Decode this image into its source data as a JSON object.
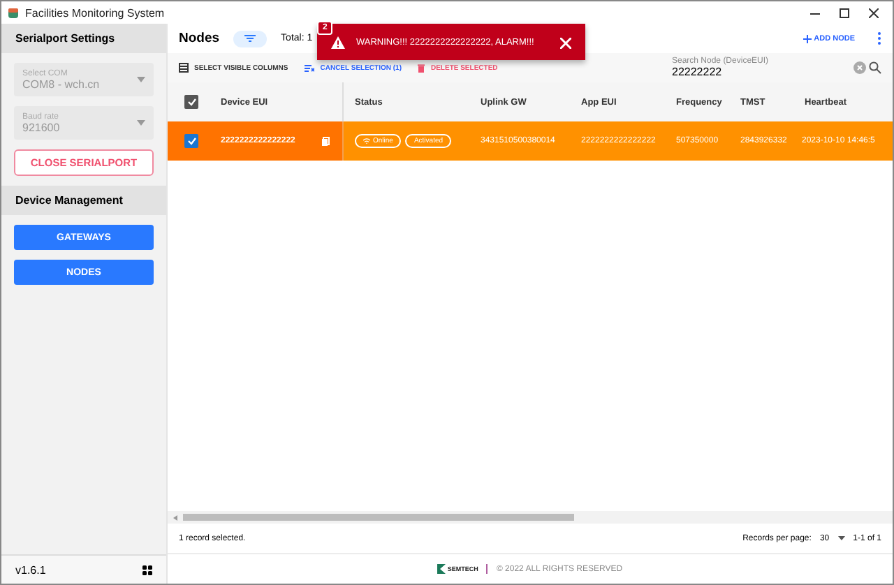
{
  "window": {
    "title": "Facilities Monitoring System"
  },
  "sidebar": {
    "serial_title": "Serialport Settings",
    "fields": [
      {
        "label": "Select COM",
        "value": "COM8 - wch.cn",
        "disabled": true
      },
      {
        "label": "Baud rate",
        "value": "921600",
        "disabled": true
      }
    ],
    "close_button": "CLOSE SERIALPORT",
    "management_title": "Device Management",
    "nav": [
      {
        "label": "GATEWAYS"
      },
      {
        "label": "NODES"
      }
    ],
    "version": "v1.6.1"
  },
  "header": {
    "title": "Nodes",
    "total": "Total: 1",
    "add_button": "ADD NODE"
  },
  "toast": {
    "count": "2",
    "message": "WARNING!!! 2222222222222222, ALARM!!!"
  },
  "toolbar": {
    "columns_button": "SELECT VISIBLE COLUMNS",
    "cancel_button": "CANCEL SELECTION (1)",
    "delete_button": "DELETE SELECTED",
    "search": {
      "label": "Search Node (DeviceEUI)",
      "value": "22222222"
    }
  },
  "table": {
    "all_checked": true,
    "columns": [
      "Device EUI",
      "Status",
      "Uplink GW",
      "App EUI",
      "Frequency",
      "TMST",
      "Heartbeat"
    ],
    "rows": [
      {
        "checked": true,
        "selected": true,
        "device_eui": "2222222222222222",
        "status": [
          "Online",
          "Activated"
        ],
        "uplink_gw": "3431510500380014",
        "app_eui": "2222222222222222",
        "frequency": "507350000",
        "tmst": "2843926332",
        "heartbeat": "2023-10-10 14:46:5"
      }
    ]
  },
  "footer": {
    "selection": "1 record selected.",
    "per_page_label": "Records per page:",
    "per_page": "30",
    "range": "1-1 of 1"
  },
  "bottom": {
    "logo": "SEMTECH",
    "copyright": "© 2022 ALL RIGHTS RESERVED"
  }
}
